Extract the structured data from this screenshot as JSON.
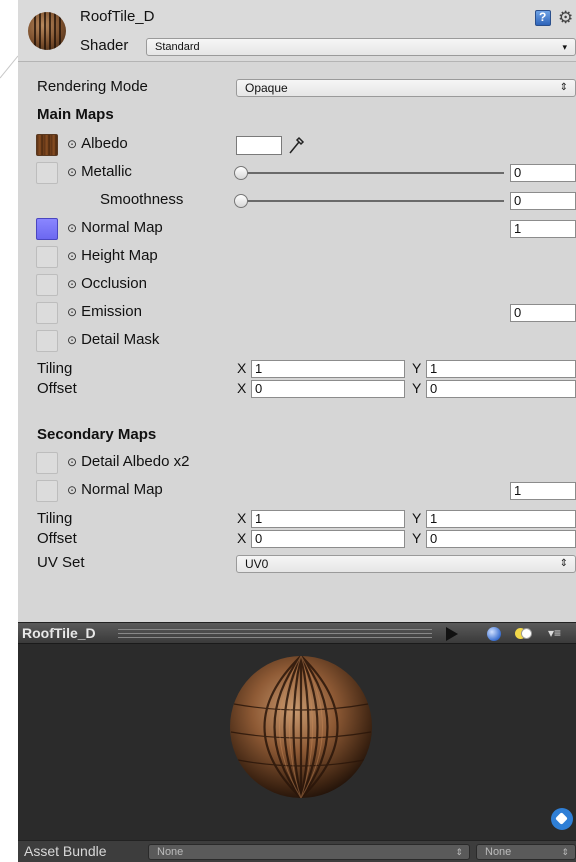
{
  "header": {
    "material_name": "RoofTile_D",
    "shader_label": "Shader",
    "shader_value": "Standard",
    "help_icon": "help-book-icon",
    "gear_icon": "gear-icon"
  },
  "rendering_mode": {
    "label": "Rendering Mode",
    "value": "Opaque"
  },
  "main_maps": {
    "heading": "Main Maps",
    "albedo": {
      "label": "Albedo",
      "color": "#ffffff"
    },
    "metallic": {
      "label": "Metallic",
      "value": "0"
    },
    "smoothness": {
      "label": "Smoothness",
      "value": "0"
    },
    "normal_map": {
      "label": "Normal Map",
      "value": "1"
    },
    "height_map": {
      "label": "Height Map"
    },
    "occlusion": {
      "label": "Occlusion"
    },
    "emission": {
      "label": "Emission",
      "value": "0"
    },
    "detail_mask": {
      "label": "Detail Mask"
    },
    "tiling": {
      "label": "Tiling",
      "x_label": "X",
      "x": "1",
      "y_label": "Y",
      "y": "1"
    },
    "offset": {
      "label": "Offset",
      "x_label": "X",
      "x": "0",
      "y_label": "Y",
      "y": "0"
    }
  },
  "secondary_maps": {
    "heading": "Secondary Maps",
    "detail_albedo": {
      "label": "Detail Albedo x2"
    },
    "normal_map": {
      "label": "Normal Map",
      "value": "1"
    },
    "tiling": {
      "label": "Tiling",
      "x_label": "X",
      "x": "1",
      "y_label": "Y",
      "y": "1"
    },
    "offset": {
      "label": "Offset",
      "x_label": "X",
      "x": "0",
      "y_label": "Y",
      "y": "0"
    },
    "uv_set": {
      "label": "UV Set",
      "value": "UV0"
    }
  },
  "preview": {
    "title": "RoofTile_D"
  },
  "asset_bundle": {
    "label": "Asset Bundle",
    "bundle_value": "None",
    "variant_value": "None"
  }
}
